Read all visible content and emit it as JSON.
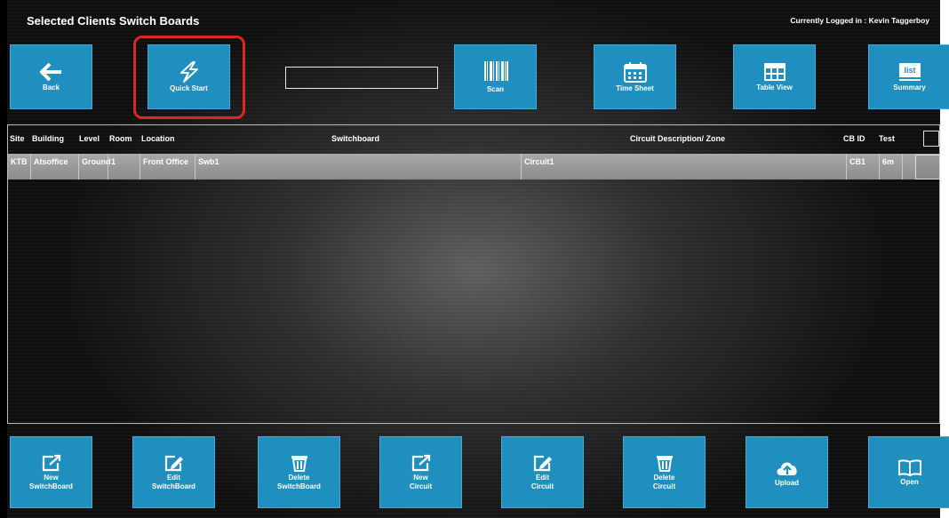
{
  "header": {
    "title": "Selected Clients Switch Boards",
    "login": "Currently Logged in : Kevin Taggerboy"
  },
  "toolbar": {
    "back": "Back",
    "quick_start": "Quick Start",
    "scan_input_value": "",
    "scan": "Scan",
    "time_sheet": "Time Sheet",
    "table_view": "Table View",
    "summary": "Summary",
    "summary_icon_text": "list"
  },
  "columns": [
    "Site",
    "Building",
    "Level",
    "Room",
    "Location",
    "Switchboard",
    "Circuit Description/ Zone",
    "CB ID",
    "Test"
  ],
  "rows": [
    {
      "site": "KTB",
      "building": "Atsoffice",
      "level": "Ground",
      "room": "1",
      "location": "Front Office",
      "switchboard": "Swb1",
      "circuit": "Circuit1",
      "cb_id": "CB1",
      "test": "6m"
    }
  ],
  "bottom": {
    "new_switchboard": [
      "New",
      "SwitchBoard"
    ],
    "edit_switchboard": [
      "Edit",
      "SwitchBoard"
    ],
    "delete_switchboard": [
      "Delete",
      "SwitchBoard"
    ],
    "new_circuit": [
      "New",
      "Circuit"
    ],
    "edit_circuit": [
      "Edit",
      "Circuit"
    ],
    "delete_circuit": [
      "Delete",
      "Circuit"
    ],
    "upload": "Upload",
    "open": "Open"
  },
  "colors": {
    "tile": "#1f8fbf",
    "highlight": "#e02424",
    "row": "#9a9a9a"
  },
  "icons": {
    "back": "arrow-left-icon",
    "quick_start": "lightning-icon",
    "scan": "barcode-icon",
    "time_sheet": "calendar-icon",
    "table_view": "table-icon",
    "summary": "list-icon",
    "new": "new-window-icon",
    "edit": "edit-pencil-icon",
    "delete": "trash-icon",
    "upload": "cloud-upload-icon",
    "open": "open-book-icon"
  }
}
